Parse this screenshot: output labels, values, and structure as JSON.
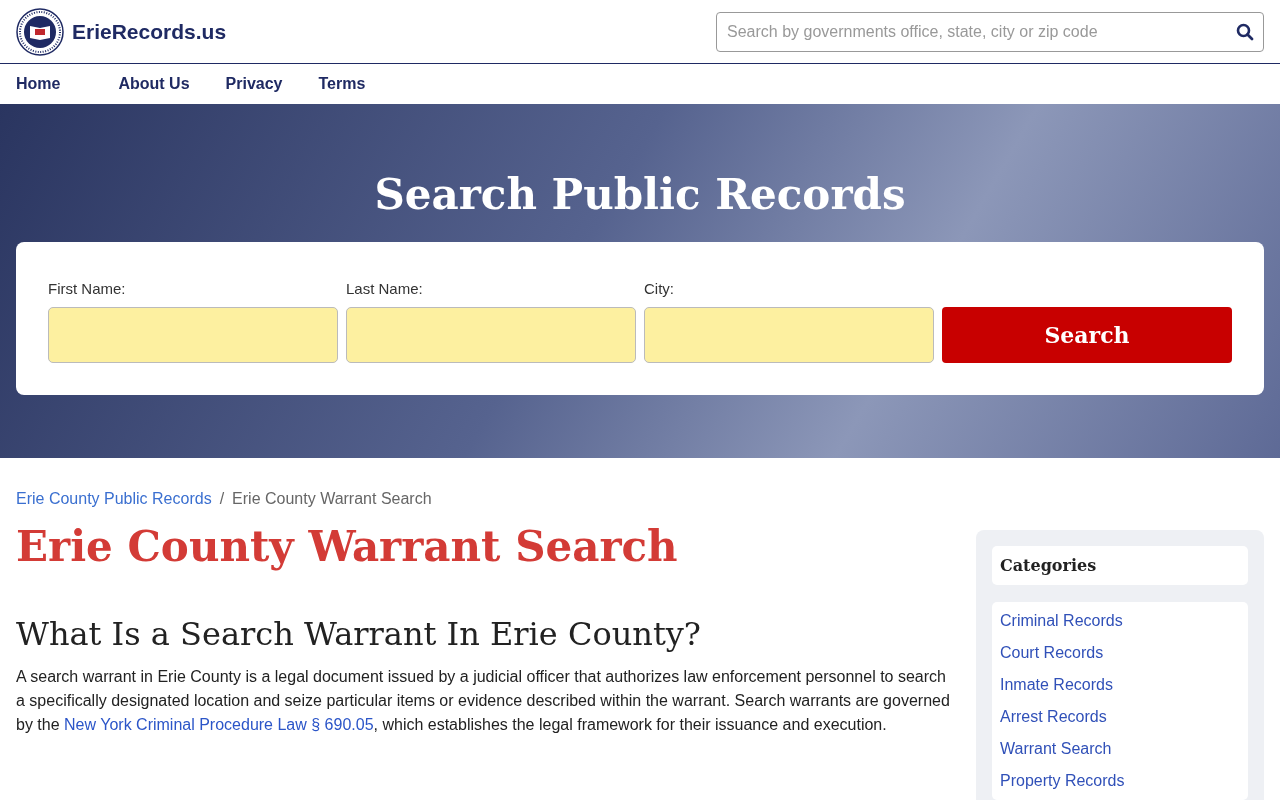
{
  "header": {
    "site_name": "ErieRecords.us",
    "search": {
      "placeholder": "Search by governments office, state, city or zip code"
    }
  },
  "nav": [
    {
      "label": "Home"
    },
    {
      "label": "About Us"
    },
    {
      "label": "Privacy"
    },
    {
      "label": "Terms"
    }
  ],
  "hero": {
    "title": "Search Public Records",
    "fields": [
      {
        "label": "First Name:"
      },
      {
        "label": "Last Name:"
      },
      {
        "label": "City:"
      }
    ],
    "button": "Search"
  },
  "breadcrumb_separator": "/",
  "breadcrumb": [
    {
      "label": "Erie County Public Records",
      "kind": "link"
    },
    {
      "label": "Erie County Warrant Search",
      "kind": "current"
    }
  ],
  "page_title": "Erie County Warrant Search",
  "section_heading": "What Is a Search Warrant In Erie County?",
  "paragraph": {
    "before": "A search warrant in Erie County is a legal document issued by a judicial officer that authorizes law enforcement personnel to search a specifically designated location and seize particular items or evidence described within the warrant. Search warrants are governed by the ",
    "link": "New York Criminal Procedure Law § 690.05",
    "after": ", which establishes the legal framework for their issuance and execution."
  },
  "sidebar": {
    "title": "Categories",
    "items": [
      {
        "label": "Criminal Records"
      },
      {
        "label": "Court Records"
      },
      {
        "label": "Inmate Records"
      },
      {
        "label": "Arrest Records"
      },
      {
        "label": "Warrant Search"
      },
      {
        "label": "Property Records"
      }
    ]
  }
}
